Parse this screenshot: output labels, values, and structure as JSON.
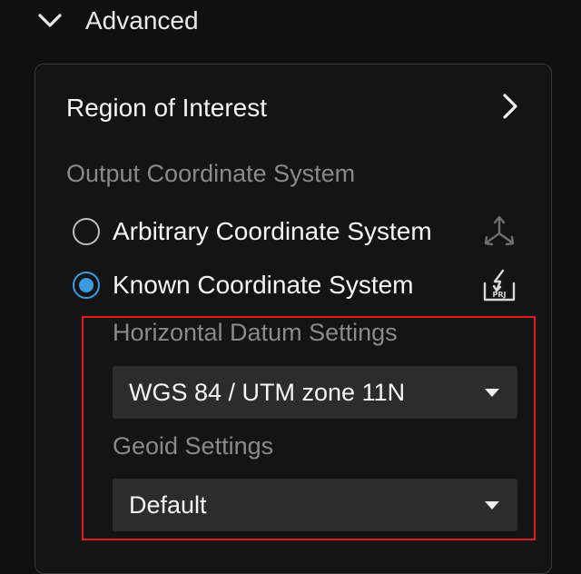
{
  "advanced": {
    "title": "Advanced",
    "chevron_icon": "chevron-down-icon"
  },
  "region_of_interest": {
    "label": "Region of Interest",
    "chevron_icon": "chevron-right-icon"
  },
  "output_coordinate_system": {
    "label": "Output Coordinate System",
    "options": [
      {
        "label": "Arbitrary Coordinate System",
        "selected": false,
        "icon": "axes-icon"
      },
      {
        "label": "Known Coordinate System",
        "selected": true,
        "icon": "import-prj-icon"
      }
    ]
  },
  "horizontal_datum": {
    "label": "Horizontal Datum Settings",
    "value": "WGS 84 / UTM zone 11N"
  },
  "geoid": {
    "label": "Geoid Settings",
    "value": "Default"
  },
  "colors": {
    "accent": "#3a9be0",
    "highlight_border": "#e01b1b",
    "select_bg": "#2c2c2c",
    "muted_text": "#8a8a8a"
  }
}
